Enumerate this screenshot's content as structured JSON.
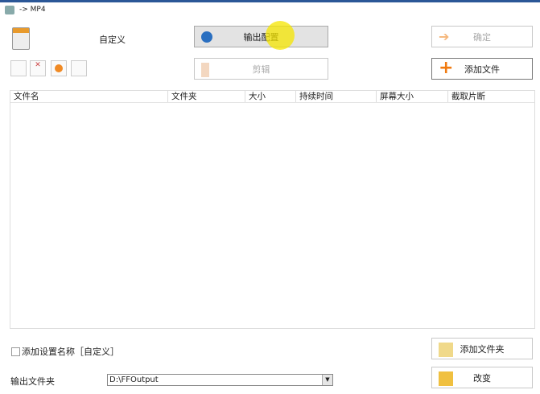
{
  "title": "-> MP4",
  "profile_label": "自定义",
  "buttons": {
    "output_config": "输出配置",
    "ok": "确定",
    "clip": "剪辑",
    "add_file": "添加文件",
    "add_folder": "添加文件夹",
    "change": "改变"
  },
  "table": {
    "columns": [
      "文件名",
      "文件夹",
      "大小",
      "持续时间",
      "屏幕大小",
      "截取片断"
    ]
  },
  "add_setting_name": "添加设置名称［自定义］",
  "output_folder_label": "输出文件夹",
  "output_folder_value": "D:\\FFOutput"
}
